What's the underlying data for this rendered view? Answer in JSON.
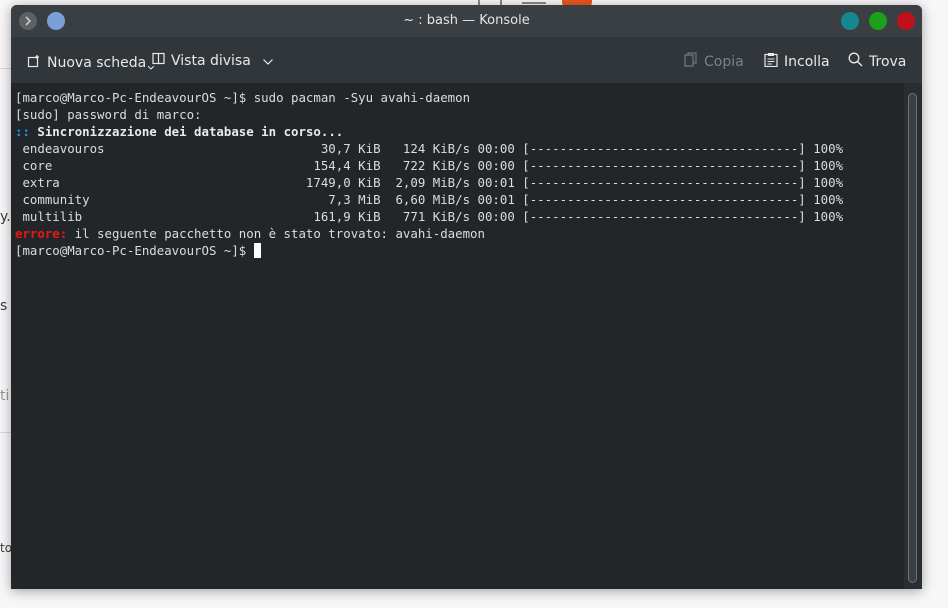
{
  "window": {
    "title": "~ : bash — Konsole"
  },
  "toolbar": {
    "new_tab": "Nuova scheda",
    "split_view": "Vista divisa",
    "copy": "Copia",
    "paste": "Incolla",
    "find": "Trova"
  },
  "background": {
    "frag1": "y.",
    "frag2": "s",
    "frag3": "ti",
    "frag4": "to"
  },
  "terminal": {
    "lines": [
      "[marco@Marco-Pc-EndeavourOS ~]$ sudo pacman -Syu avahi-daemon",
      "[sudo] password di marco:",
      "Sincronizzazione dei database in corso...",
      " endeavouros                             30,7 KiB   124 KiB/s 00:00 [------------------------------------] 100%",
      " core                                   154,4 KiB   722 KiB/s 00:00 [------------------------------------] 100%",
      " extra                                 1749,0 KiB  2,09 MiB/s 00:01 [------------------------------------] 100%",
      " community                                7,3 MiB  6,60 MiB/s 00:01 [------------------------------------] 100%",
      " multilib                               161,9 KiB   771 KiB/s 00:00 [------------------------------------] 100%",
      " il seguente pacchetto non è stato trovato: avahi-daemon",
      "[marco@Marco-Pc-EndeavourOS ~]$ "
    ],
    "sync_prefix": "::",
    "error_prefix": "errore:"
  },
  "colors": {
    "close": "#c0101a",
    "maximize": "#1aa01a",
    "minimize": "#17878f",
    "accent": "#1d99f3",
    "error": "#ed1515"
  }
}
